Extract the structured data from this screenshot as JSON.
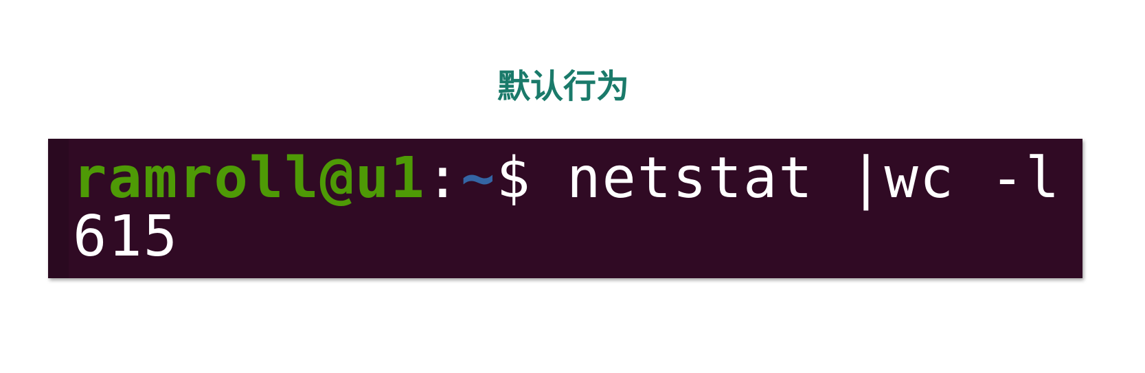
{
  "heading": "默认行为",
  "terminal": {
    "prompt": {
      "user_host": "ramroll@u1",
      "separator": ":",
      "cwd": "~",
      "sign": "$"
    },
    "command": " netstat |wc -l",
    "output": "615",
    "colors": {
      "background": "#300a24",
      "user_host": "#4e9a06",
      "cwd": "#3465a4",
      "text": "#ffffff",
      "heading": "#1a7a6a"
    }
  }
}
